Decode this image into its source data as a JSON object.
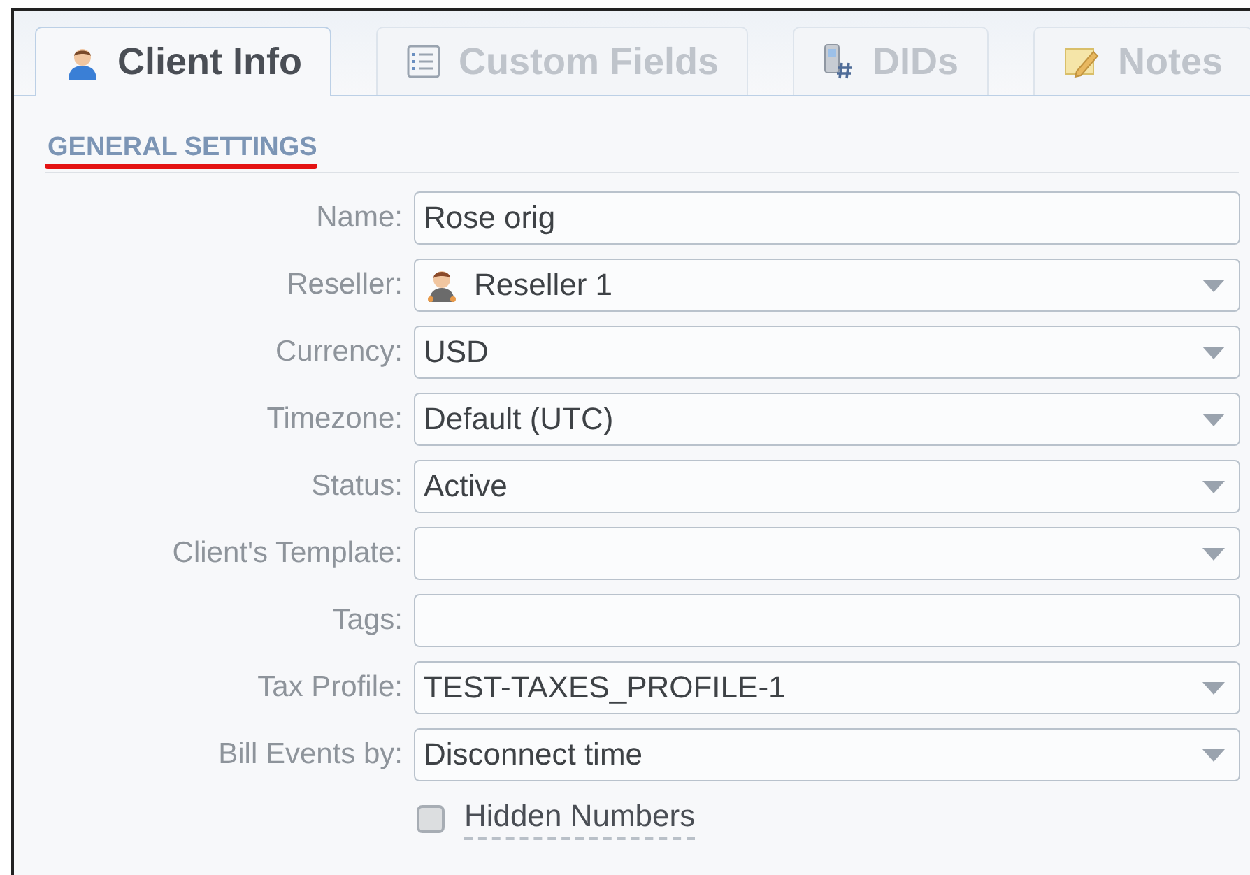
{
  "tabs": [
    {
      "label": "Client Info",
      "selected": true
    },
    {
      "label": "Custom Fields",
      "selected": false
    },
    {
      "label": "DIDs",
      "selected": false
    },
    {
      "label": "Notes",
      "selected": false
    }
  ],
  "section_title": "GENERAL SETTINGS",
  "fields": [
    {
      "label": "Name:",
      "kind": "text",
      "value": "Rose orig"
    },
    {
      "label": "Reseller:",
      "kind": "select_user",
      "value": "Reseller 1"
    },
    {
      "label": "Currency:",
      "kind": "select",
      "value": "USD"
    },
    {
      "label": "Timezone:",
      "kind": "select",
      "value": "Default (UTC)"
    },
    {
      "label": "Status:",
      "kind": "select",
      "value": "Active"
    },
    {
      "label": "Client's Template:",
      "kind": "select"
    },
    {
      "label": "Tags:",
      "kind": "text"
    },
    {
      "label": "Tax Profile:",
      "kind": "select",
      "value": "TEST-TAXES_PROFILE-1"
    },
    {
      "label": "Bill Events by:",
      "kind": "select",
      "value": "Disconnect time"
    }
  ],
  "hidden_numbers": {
    "label": "Hidden Numbers",
    "checked": false
  }
}
